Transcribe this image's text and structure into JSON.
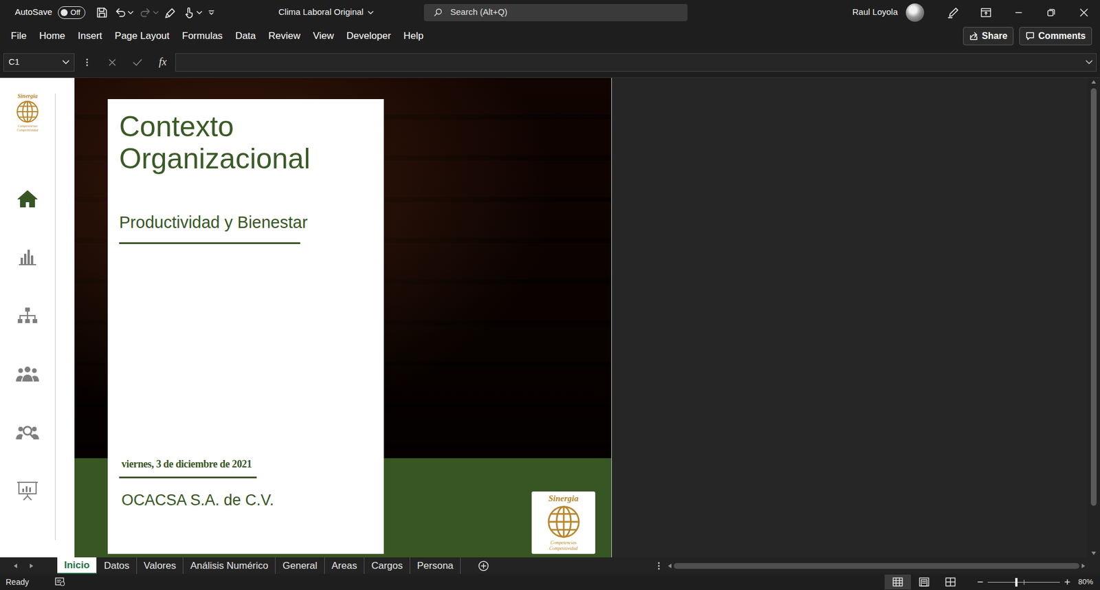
{
  "window": {
    "title": "Clima Laboral Original"
  },
  "autosave": {
    "label": "AutoSave",
    "state": "Off",
    "on": false
  },
  "quick_access": [
    {
      "disabled": false
    },
    {
      "disabled": false
    },
    {
      "disabled": true
    },
    {
      "disabled": false
    },
    {
      "disabled": false
    }
  ],
  "search": {
    "placeholder": "Search (Alt+Q)"
  },
  "user": {
    "name": "Raul Loyola"
  },
  "menu": [
    "File",
    "Home",
    "Insert",
    "Page Layout",
    "Formulas",
    "Data",
    "Review",
    "View",
    "Developer",
    "Help"
  ],
  "actions": {
    "share": "Share",
    "comments": "Comments"
  },
  "formula_bar": {
    "name_box": "C1",
    "fx": "fx"
  },
  "sidebar": {
    "logo": {
      "name": "Sinergia",
      "line1": "Competencias",
      "line2": "Competitividad"
    },
    "items": [
      {
        "selected": true
      },
      {
        "selected": false
      },
      {
        "selected": false
      },
      {
        "selected": false
      },
      {
        "selected": false
      },
      {
        "selected": false
      }
    ]
  },
  "dashboard": {
    "title": "Contexto Organizacional",
    "subtitle": "Productividad y Bienestar",
    "date": "viernes, 3 de diciembre de 2021",
    "company": "OCACSA S.A. de C.V.",
    "logo": {
      "name": "Sinergia",
      "line1": "Competencias",
      "line2": "Competitividad"
    }
  },
  "sheet_tabs": [
    {
      "label": "Inicio",
      "selected": true
    },
    {
      "label": "Datos",
      "selected": false
    },
    {
      "label": "Valores",
      "selected": false
    },
    {
      "label": "Análisis Numérico",
      "selected": false
    },
    {
      "label": "General",
      "selected": false
    },
    {
      "label": "Areas",
      "selected": false
    },
    {
      "label": "Cargos",
      "selected": false
    },
    {
      "label": "Persona",
      "selected": false
    }
  ],
  "status_bar": {
    "mode": "Ready",
    "views": [
      {
        "selected": true
      },
      {
        "selected": false
      },
      {
        "selected": false
      }
    ],
    "zoom": {
      "level": 0.4,
      "reading": "80%"
    }
  }
}
